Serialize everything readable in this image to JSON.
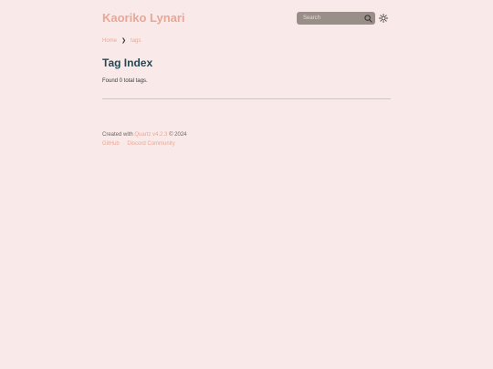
{
  "header": {
    "site_title": "Kaoriko Lynari",
    "search_placeholder": "Search",
    "search_icon": "search-icon",
    "theme_icon": "sun-icon"
  },
  "breadcrumb": {
    "items": [
      "Home",
      "tags"
    ],
    "separator": "❯"
  },
  "main": {
    "title": "Tag Index",
    "found_text": "Found 0 total tags."
  },
  "footer": {
    "created_with": "Created with",
    "quartz_link": "Quartz v4.2.3",
    "copyright": "© 2024",
    "links": [
      "GitHub",
      "Discord Community"
    ]
  },
  "colors": {
    "background": "#f9eae9",
    "accent": "#e8a796",
    "title": "#274955",
    "search_bg": "#9a8f88"
  }
}
